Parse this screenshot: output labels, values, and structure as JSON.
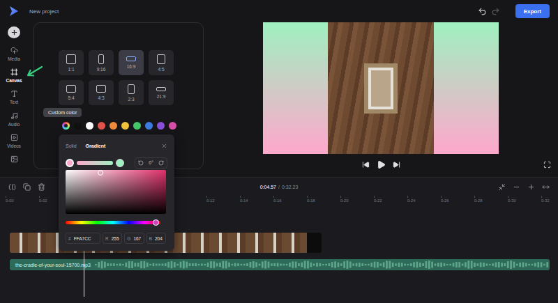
{
  "header": {
    "title": "New project",
    "export": "Export"
  },
  "sidebar": {
    "items": [
      {
        "label": "Media",
        "selected": false
      },
      {
        "label": "Canvas",
        "selected": true
      },
      {
        "label": "Text",
        "selected": false
      },
      {
        "label": "Audio",
        "selected": false
      },
      {
        "label": "Videos",
        "selected": false
      },
      {
        "label": "",
        "selected": false
      }
    ]
  },
  "canvas_panel": {
    "ratios": [
      {
        "label": "1:1",
        "selected": false
      },
      {
        "label": "9:16",
        "selected": false
      },
      {
        "label": "16:9",
        "selected": true
      },
      {
        "label": "4:5",
        "selected": false
      },
      {
        "label": "5:4",
        "selected": false
      },
      {
        "label": "4:3",
        "selected": false
      },
      {
        "label": "2:3",
        "selected": false
      },
      {
        "label": "21:9",
        "selected": false
      }
    ],
    "tooltip": "Custom color",
    "swatches": [
      {
        "kind": "custom",
        "selected": false
      },
      {
        "kind": "solid",
        "color": "#111111",
        "selected": false
      },
      {
        "kind": "solid",
        "color": "#ffffff",
        "selected": false
      },
      {
        "kind": "solid",
        "color": "#e2534b",
        "selected": false
      },
      {
        "kind": "solid",
        "color": "#f08a3c",
        "selected": false
      },
      {
        "kind": "solid",
        "color": "#f2c13a",
        "selected": false
      },
      {
        "kind": "solid",
        "color": "#46c46a",
        "selected": false
      },
      {
        "kind": "solid",
        "color": "#3d7be0",
        "selected": false
      },
      {
        "kind": "solid",
        "color": "#8a4fd8",
        "selected": false
      },
      {
        "kind": "solid",
        "color": "#d64fa6",
        "selected": false
      }
    ]
  },
  "color_popup": {
    "tabs": [
      {
        "label": "Solid",
        "selected": false
      },
      {
        "label": "Gradient",
        "selected": true
      }
    ],
    "stops": [
      {
        "color": "#ffa7cc",
        "selected": true
      },
      {
        "color": "#9ff0c0",
        "selected": false
      }
    ],
    "angle": "0°",
    "hue_color": "#e0306a",
    "handle": {
      "x": 0.35,
      "y": 0.02
    },
    "hue_level": 0.95,
    "fields": [
      {
        "label": "#",
        "value": "FFA7CC"
      },
      {
        "label": "R",
        "value": "255"
      },
      {
        "label": "G",
        "value": "167"
      },
      {
        "label": "B",
        "value": "204"
      }
    ]
  },
  "preview": {
    "playing": false
  },
  "timeline": {
    "current": "0:04.57",
    "separator": "/",
    "total": "0:32.23",
    "ticks": [
      "0:00",
      "0:02",
      "0:12",
      "0:14",
      "0:16",
      "0:18",
      "0:20",
      "0:22",
      "0:24",
      "0:26",
      "0:28",
      "0:30",
      "0:32"
    ],
    "audio": {
      "label": "the-cradle-of-your-soul-15700.mp3"
    }
  }
}
